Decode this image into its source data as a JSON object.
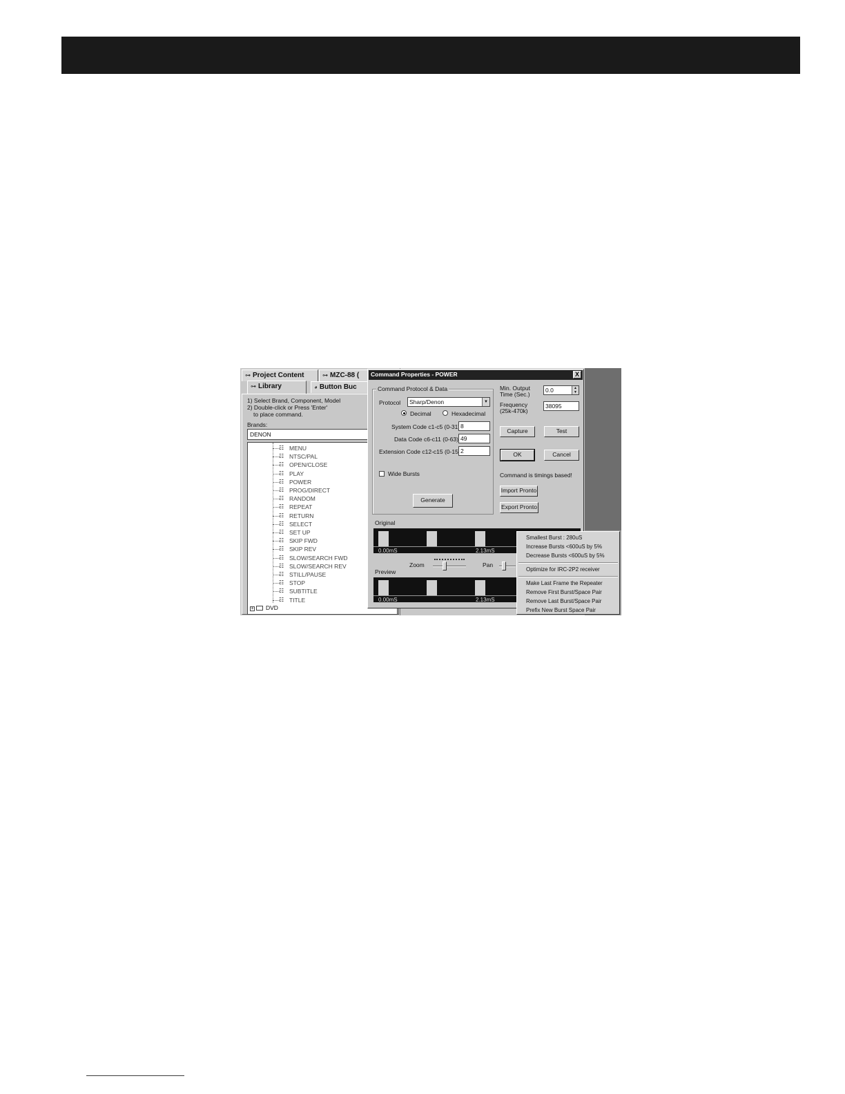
{
  "screenshot": {
    "left_panel": {
      "tabs": {
        "project_content": "Project Content",
        "mzc": "MZC-88 (",
        "library": "Library",
        "button_bucket": "Button Buc"
      },
      "instructions": [
        "1) Select Brand, Component, Model",
        "2) Double-click or Press 'Enter'",
        "to place command."
      ],
      "brands_label": "Brands:",
      "brand_value": "DENON",
      "commands": [
        "MENU",
        "NTSC/PAL",
        "OPEN/CLOSE",
        "PLAY",
        "POWER",
        "PROG/DIRECT",
        "RANDOM",
        "REPEAT",
        "RETURN",
        "SELECT",
        "SET UP",
        "SKIP FWD",
        "SKIP REV",
        "SLOW/SEARCH FWD",
        "SLOW/SEARCH REV",
        "STILL/PAUSE",
        "STOP",
        "SUBTITLE",
        "TITLE"
      ],
      "folder": "DVD"
    },
    "dialog": {
      "title": "Command Properties - POWER",
      "close": "X",
      "group_title": "Command Protocol & Data",
      "protocol_label": "Protocol",
      "protocol_value": "Sharp/Denon",
      "radio_decimal": "Decimal",
      "radio_hex": "Hexadecimal",
      "system_code_label": "System Code c1-c5 (0-31)",
      "system_code_value": "8",
      "data_code_label": "Data Code c6-c11 (0-63)",
      "data_code_value": "49",
      "ext_code_label": "Extension Code c12-c15 (0-15)",
      "ext_code_value": "2",
      "wide_bursts": "Wide Bursts",
      "generate": "Generate",
      "min_output_label": "Min. Output Time (Sec.)",
      "min_output_value": "0.0",
      "frequency_label": "Frequency (25k-470k)",
      "frequency_value": "38095",
      "capture": "Capture",
      "test": "Test",
      "ok": "OK",
      "cancel": "Cancel",
      "timings_note": "Command is timings based!",
      "import_pronto": "Import Pronto",
      "export_pronto": "Export Pronto",
      "original_label": "Original",
      "preview_label": "Preview",
      "time_start": "0.00mS",
      "time_mid": "2.13mS",
      "zoom_label": "Zoom",
      "pan_label": "Pan"
    },
    "context_menu": {
      "items": [
        "Smallest Burst : 280uS",
        "Increase Bursts <600uS by 5%",
        "Decrease Bursts <600uS by 5%",
        "Optimize for IRC-2P2 receiver",
        "Make Last Frame the Repeater",
        "Remove First Burst/Space Pair",
        "Remove Last Burst/Space Pair",
        "Prefix New Burst Space Pair"
      ]
    }
  }
}
